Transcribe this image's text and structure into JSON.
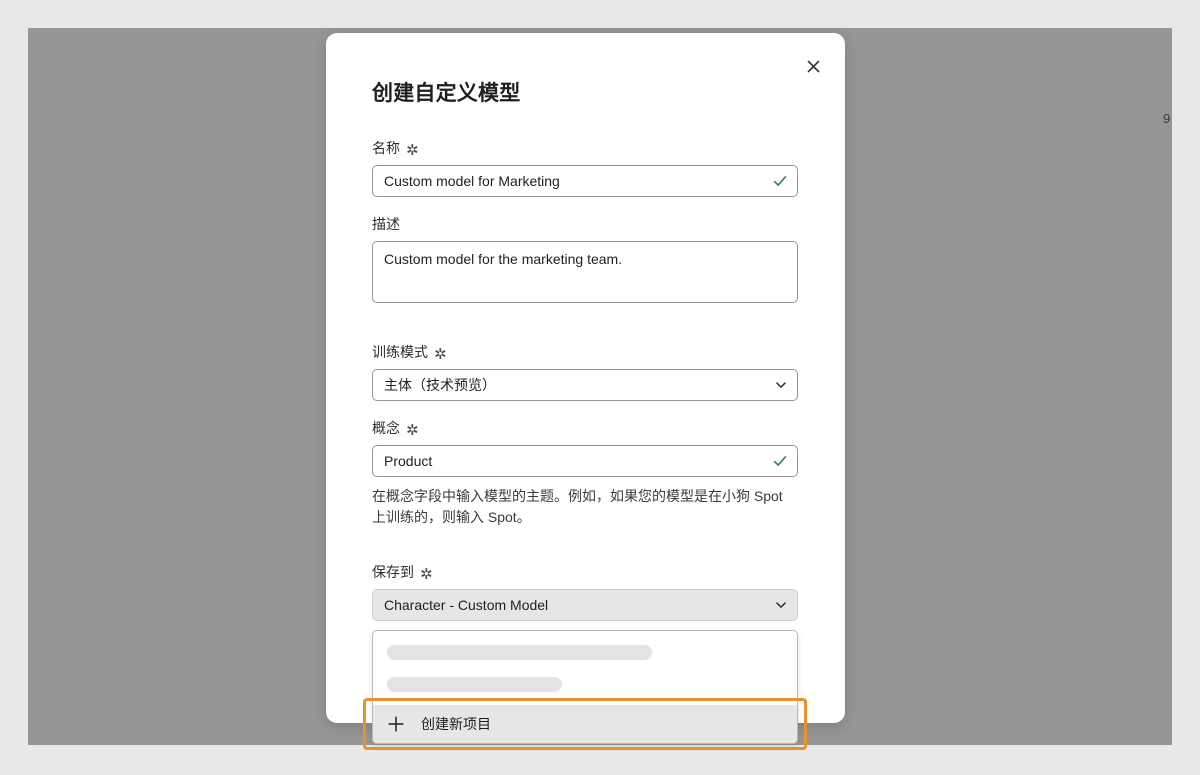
{
  "modal": {
    "title": "创建自定义模型",
    "close_label": "关闭",
    "close_icon": "close-icon"
  },
  "fields": {
    "name": {
      "label": "名称",
      "required_marker": "✲",
      "value": "Custom model for Marketing",
      "placeholder": "",
      "valid_icon": "checkmark-icon"
    },
    "description": {
      "label": "描述",
      "value": "Custom model for the marketing team.",
      "placeholder": ""
    },
    "training_mode": {
      "label": "训练模式",
      "required_marker": "✲",
      "value": "主体（技术预览）",
      "chevron_icon": "chevron-down-icon"
    },
    "concept": {
      "label": "概念",
      "required_marker": "✲",
      "value": "Product",
      "placeholder": "",
      "valid_icon": "checkmark-icon",
      "help_text": "在概念字段中输入模型的主题。例如，如果您的模型是在小狗 Spot 上训练的，则输入 Spot。"
    },
    "save_to": {
      "label": "保存到",
      "required_marker": "✲",
      "value": "Character - Custom Model",
      "chevron_icon": "chevron-down-icon"
    }
  },
  "dropdown": {
    "loading_placeholders": [
      "",
      ""
    ],
    "create_new": {
      "label": "创建新项目",
      "icon": "plus-icon"
    }
  },
  "edge": {
    "fragment_text": "9"
  },
  "colors": {
    "highlight_border": "#e8912d",
    "valid_check": "#2a7f62",
    "backdrop": "#969696",
    "page_background": "#e8e8e8",
    "modal_background": "#ffffff",
    "skeleton": "#e3e3e3",
    "active_field": "#e6e6e6"
  }
}
